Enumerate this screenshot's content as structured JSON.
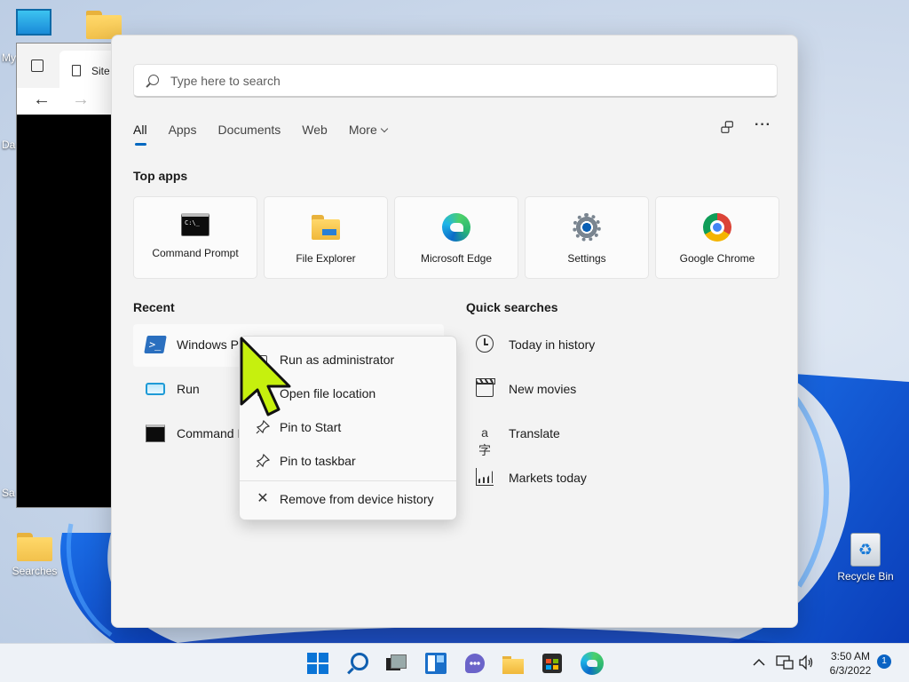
{
  "desktop": {
    "icons": [
      {
        "label": "Searches"
      },
      {
        "label": "Recycle Bin"
      }
    ],
    "edge_fragments": [
      "My",
      "Da",
      "Sa"
    ]
  },
  "background_window": {
    "tab_title": "Site"
  },
  "search": {
    "placeholder": "Type here to search"
  },
  "tabs": [
    {
      "label": "All",
      "active": true
    },
    {
      "label": "Apps"
    },
    {
      "label": "Documents"
    },
    {
      "label": "Web"
    },
    {
      "label": "More"
    }
  ],
  "top_apps": {
    "heading": "Top apps",
    "items": [
      {
        "label": "Command Prompt",
        "icon": "command-prompt-icon"
      },
      {
        "label": "File Explorer",
        "icon": "file-explorer-icon"
      },
      {
        "label": "Microsoft Edge",
        "icon": "edge-icon"
      },
      {
        "label": "Settings",
        "icon": "settings-gear-icon"
      },
      {
        "label": "Google Chrome",
        "icon": "chrome-icon"
      }
    ]
  },
  "recent": {
    "heading": "Recent",
    "items": [
      {
        "label": "Windows Po",
        "icon": "powershell-icon"
      },
      {
        "label": "Run",
        "icon": "run-icon"
      },
      {
        "label": "Command P",
        "icon": "command-prompt-icon"
      }
    ]
  },
  "quick_searches": {
    "heading": "Quick searches",
    "items": [
      {
        "label": "Today in history",
        "icon": "clock-icon"
      },
      {
        "label": "New movies",
        "icon": "clapperboard-icon"
      },
      {
        "label": "Translate",
        "icon": "translate-icon"
      },
      {
        "label": "Markets today",
        "icon": "chart-icon"
      }
    ]
  },
  "context_menu": {
    "items": [
      {
        "label": "Run as administrator",
        "icon": "shield-icon"
      },
      {
        "label": "Open file location",
        "icon": "folder-open-icon"
      },
      {
        "label": "Pin to Start",
        "icon": "pin-icon"
      },
      {
        "label": "Pin to taskbar",
        "icon": "pin-icon"
      },
      {
        "label": "Remove from device history",
        "icon": "close-icon"
      }
    ]
  },
  "taskbar": {
    "time": "3:50 AM",
    "date": "6/3/2022",
    "notification_count": "1"
  },
  "colors": {
    "accent": "#0067c0",
    "cursor": "#c6f00e"
  }
}
